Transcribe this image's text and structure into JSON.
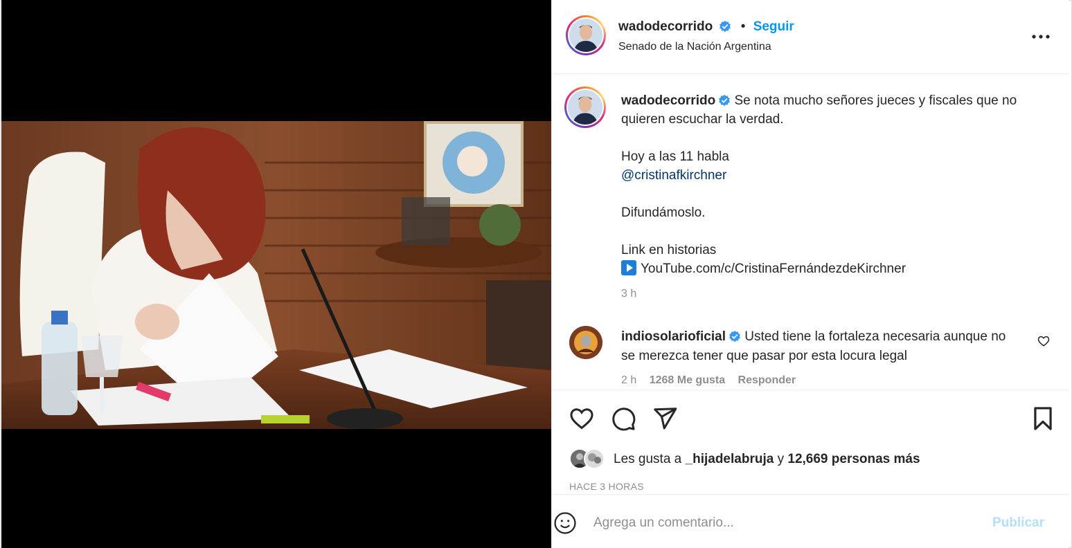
{
  "post": {
    "username": "wadodecorrido",
    "follow_label": "Seguir",
    "separator": "•",
    "location": "Senado de la Nación Argentina",
    "more_icon": "more-horizontal-icon"
  },
  "caption": {
    "username": "wadodecorrido",
    "line1": "Se nota mucho señores jueces y fiscales que no quieren escuchar la verdad.",
    "line2": "Hoy a las 11 habla",
    "mention": "@cristinafkirchner",
    "line3": "Difundámoslo.",
    "line4": "Link en historias",
    "link": "YouTube.com/c/CristinaFernándezdeKirchner",
    "time": "3 h"
  },
  "comment": {
    "username": "indiosolarioficial",
    "text": "Usted tiene la fortaleza necesaria aunque no se merezca tener que pasar por esta locura legal",
    "time": "2 h",
    "likes": "1268 Me gusta",
    "reply": "Responder"
  },
  "likes": {
    "prefix": "Les gusta a",
    "user": "_hijadelabruja",
    "conj": "y",
    "others": "12,669 personas más"
  },
  "timestamp": "HACE 3 HORAS",
  "add_comment": {
    "placeholder": "Agrega un comentario...",
    "publish_label": "Publicar"
  },
  "colors": {
    "accent": "#0095f6",
    "publish_disabled": "#b2dffc",
    "mention": "#00376b",
    "verified": "#3897f0"
  }
}
